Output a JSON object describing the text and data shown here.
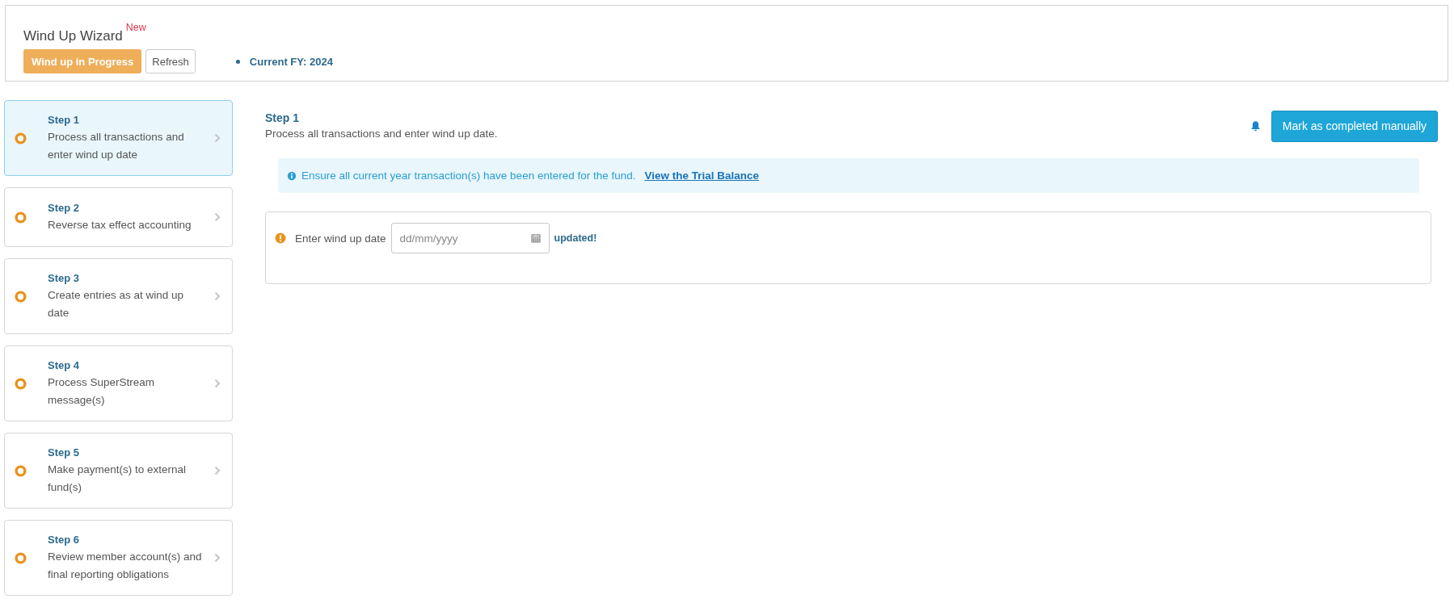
{
  "header": {
    "title": "Wind Up Wizard",
    "badge": "New",
    "status_button": "Wind up in Progress",
    "refresh_button": "Refresh",
    "current_fy": "Current FY: 2024"
  },
  "steps": [
    {
      "title": "Step 1",
      "description": "Process all transactions and enter wind up date",
      "selected": true
    },
    {
      "title": "Step 2",
      "description": "Reverse tax effect accounting",
      "selected": false
    },
    {
      "title": "Step 3",
      "description": "Create entries as at wind up date",
      "selected": false
    },
    {
      "title": "Step 4",
      "description": "Process SuperStream message(s)",
      "selected": false
    },
    {
      "title": "Step 5",
      "description": "Make payment(s) to external fund(s)",
      "selected": false
    },
    {
      "title": "Step 6",
      "description": "Review member account(s) and final reporting obligations",
      "selected": false
    }
  ],
  "detail": {
    "title": "Step 1",
    "subtitle": "Process all transactions and enter wind up date.",
    "mark_button": "Mark as completed manually",
    "info": {
      "text": "Ensure all current year transaction(s) have been entered for the fund.",
      "link": "View the Trial Balance"
    },
    "date_field": {
      "label": "Enter wind up date",
      "placeholder": "dd/mm/yyyy",
      "status": "updated!"
    }
  }
}
